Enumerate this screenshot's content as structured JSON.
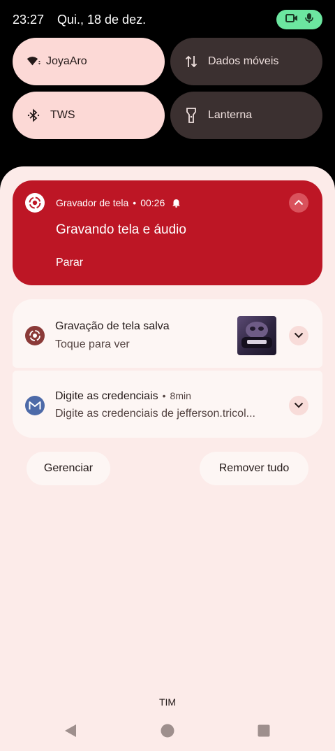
{
  "status_bar": {
    "time": "23:27",
    "date": "Qui., 18 de dez.",
    "privacy_chip_color": "#6ce6a0",
    "icons": [
      "videocam-icon",
      "mic-icon"
    ]
  },
  "quick_settings": {
    "tiles": [
      {
        "label": "JoyaAro",
        "icon": "wifi-icon",
        "state": "on"
      },
      {
        "label": "Dados móveis",
        "icon": "mobile-data-icon",
        "state": "off"
      },
      {
        "label": "TWS",
        "icon": "bluetooth-icon",
        "state": "on"
      },
      {
        "label": "Lanterna",
        "icon": "flashlight-icon",
        "state": "off"
      }
    ]
  },
  "recording_notification": {
    "app_name": "Gravador de tela",
    "separator": "•",
    "elapsed": "00:26",
    "title": "Gravando tela e áudio",
    "action_label": "Parar",
    "accent": "#bd1625"
  },
  "notifications": [
    {
      "title": "Gravação de tela salva",
      "subtitle": "Toque para ver",
      "icon": "screen-record-icon",
      "has_thumbnail": true
    },
    {
      "title": "Digite as credenciais",
      "time": "8min",
      "separator": "•",
      "subtitle": "Digite as credenciais de jefferson.tricol...",
      "icon": "gmail-icon"
    }
  ],
  "footer_buttons": {
    "manage": "Gerenciar",
    "clear_all": "Remover tudo"
  },
  "carrier": "TIM",
  "nav_bar": [
    "back-icon",
    "home-icon",
    "recents-icon"
  ]
}
